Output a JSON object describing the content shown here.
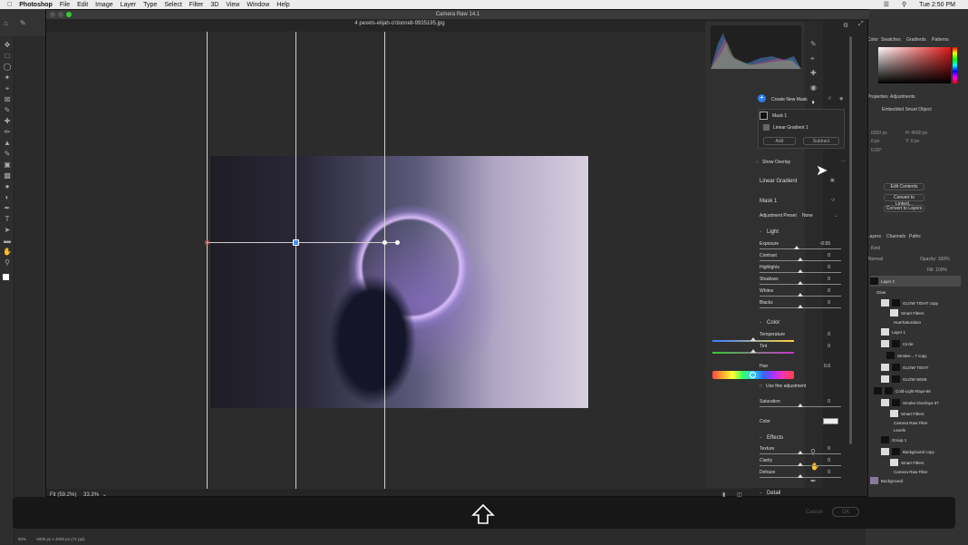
{
  "menubar": {
    "app": "Photoshop",
    "items": [
      "File",
      "Edit",
      "Image",
      "Layer",
      "Type",
      "Select",
      "Filter",
      "3D",
      "View",
      "Window",
      "Help"
    ],
    "clock": "Tue 2:50 PM"
  },
  "dialog": {
    "title": "Camera Raw 14.1",
    "filename": "4 pexels-elijah-o'donnell-9935195.jpg",
    "zoom_fit": "Fit (59.2%)",
    "zoom_pct": "33.3%",
    "cancel": "Cancel",
    "ok": "OK"
  },
  "mask_panel": {
    "create_new_mask": "Create New Mask",
    "mask_name": "Mask 1",
    "component": "Linear Gradient 1",
    "add": "Add",
    "subtract": "Subtract",
    "show_overlay": "Show Overlay",
    "tool_title": "Linear Gradient",
    "mask_title": "Mask 1",
    "adjustment_preset_label": "Adjustment Preset",
    "adjustment_preset_value": "None"
  },
  "light": {
    "header": "Light",
    "sliders": [
      {
        "label": "Exposure",
        "value": "-0.55"
      },
      {
        "label": "Contrast",
        "value": "0"
      },
      {
        "label": "Highlights",
        "value": "0"
      },
      {
        "label": "Shadows",
        "value": "0"
      },
      {
        "label": "Whites",
        "value": "0"
      },
      {
        "label": "Blacks",
        "value": "0"
      }
    ]
  },
  "color": {
    "header": "Color",
    "temperature": "Temperature",
    "temperature_value": "0",
    "tint": "Tint",
    "tint_value": "0",
    "hue": "Hue",
    "hue_value": "0.0",
    "fine_adj": "Use fine adjustment",
    "saturation": "Saturation",
    "saturation_value": "0",
    "color_label": "Color"
  },
  "effects": {
    "header": "Effects",
    "sliders": [
      {
        "label": "Texture",
        "value": "0"
      },
      {
        "label": "Clarity",
        "value": "0"
      },
      {
        "label": "Dehaze",
        "value": "0"
      }
    ]
  },
  "detail": {
    "header": "Detail"
  },
  "ps_right": {
    "tabs_top": [
      "Color",
      "Swatches",
      "Gradients",
      "Patterns"
    ],
    "tabs_mid": [
      "Properties",
      "Adjustments"
    ],
    "smart_object": "Embedded Smart Object",
    "buttons": [
      "Edit Contents",
      "Convert to Linked...",
      "Convert to Layers"
    ],
    "props": [
      "6000 px",
      "H: 4000 px",
      "0 px",
      "Y: 0 px",
      "0.00°"
    ],
    "layers_tabs": [
      "Layers",
      "Channels",
      "Paths"
    ],
    "opacity": "Opacity: 100%",
    "fill": "Fill: 100%",
    "blend": "Normal",
    "kind": "Kind",
    "layers": [
      "Layer 2",
      "Glow",
      "GLOW TIGHT copy",
      "Smart Filters",
      "Hue/Saturation",
      "Layer 1",
      "Circle",
      "Smoke-...7 copy",
      "GLOW TIGHT",
      "GLOW WIDE",
      "Cold-Light-Rays-66",
      "Smoke-Overlays-37",
      "Smart Filters",
      "Camera Raw Filter",
      "Levels",
      "Group 1",
      "Background copy",
      "Smart Filters",
      "Camera Raw Filter",
      "Background"
    ]
  },
  "status": {
    "zoom": "50%",
    "doc": "6000 px x 4000 px (72 ppi)"
  }
}
